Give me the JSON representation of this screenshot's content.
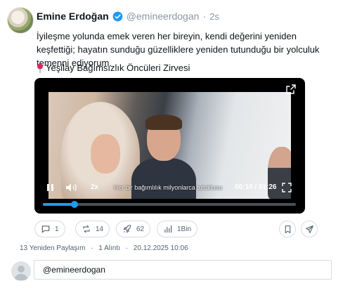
{
  "tweet": {
    "author_name": "Emine Erdoğan",
    "handle": "@emineerdogan",
    "time_ago": "2s",
    "text": "İyileşme yolunda emek veren her bireyin, kendi değerini yeniden keşfettiği; hayatın sunduğu güzelliklere yeniden tutunduğu bir yolculuk temenni ediyorum.",
    "location_label": "Yeşilay Bağımsızlık Öncüleri Zirvesi",
    "accent_color": "#1d9bf0"
  },
  "video": {
    "caption": "Her bir bağımlılık milyonlarca tutuklusu",
    "speed": "2x",
    "current_time": "00:10",
    "duration": "01:26",
    "time_separator": "/",
    "progress": 0.125,
    "icons": [
      "expand-icon",
      "pause-icon",
      "volume-icon",
      "fullscreen-icon"
    ]
  },
  "actions": {
    "replies": "1",
    "retweets": "14",
    "likes": "62",
    "views": "1Bin"
  },
  "meta": {
    "retweets_label": "13 Yeniden Paylaşım",
    "quotes_label": "1 Alıntı",
    "timestamp": "20.12.2025 10:06",
    "separator": "·"
  },
  "reply": {
    "value": "@emineerdogan"
  }
}
